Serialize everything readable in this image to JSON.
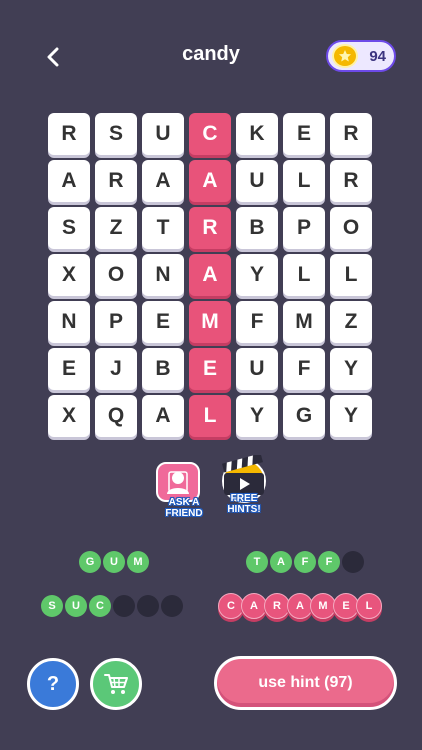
{
  "header": {
    "title": "candy",
    "coins": "94"
  },
  "grid": [
    [
      "R",
      "S",
      "U",
      "C",
      "K",
      "E",
      "R"
    ],
    [
      "A",
      "R",
      "A",
      "A",
      "U",
      "L",
      "R"
    ],
    [
      "S",
      "Z",
      "T",
      "R",
      "B",
      "P",
      "O"
    ],
    [
      "X",
      "O",
      "N",
      "A",
      "Y",
      "L",
      "L"
    ],
    [
      "N",
      "P",
      "E",
      "M",
      "F",
      "M",
      "Z"
    ],
    [
      "E",
      "J",
      "B",
      "E",
      "U",
      "F",
      "Y"
    ],
    [
      "X",
      "Q",
      "A",
      "L",
      "Y",
      "G",
      "Y"
    ]
  ],
  "found_column": 3,
  "helpers": {
    "ask_label_1": "ASK A",
    "ask_label_2": "FRIEND",
    "hints_label_1": "FREE",
    "hints_label_2": "HINTS!"
  },
  "words": {
    "gum": [
      "G",
      "U",
      "M"
    ],
    "taffy": [
      "T",
      "A",
      "F",
      "F",
      ""
    ],
    "sucker": [
      "S",
      "U",
      "C",
      "",
      "",
      ""
    ],
    "caramel": [
      "C",
      "A",
      "R",
      "A",
      "M",
      "E",
      "L"
    ]
  },
  "buttons": {
    "help": "?",
    "hint": "use hint (97)"
  },
  "colors": {
    "background": "#413e54",
    "found": "#e8537a",
    "word_green": "#5fc86a"
  }
}
